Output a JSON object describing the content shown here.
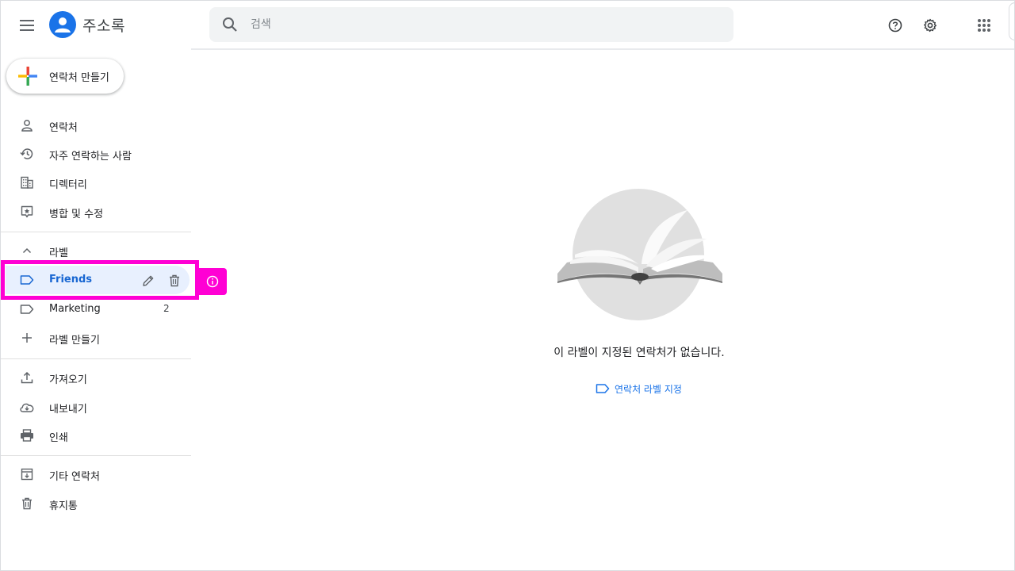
{
  "header": {
    "app_title": "주소록",
    "search_placeholder": "검색",
    "icons": {
      "menu": "hamburger-menu-icon",
      "logo": "contacts-person-icon",
      "search": "search-icon",
      "help": "help-icon",
      "settings": "gear-icon",
      "apps": "apps-grid-icon"
    }
  },
  "sidebar": {
    "create_label": "연락처 만들기",
    "nav": [
      {
        "label": "연락처",
        "icon": "person-icon"
      },
      {
        "label": "자주 연락하는 사람",
        "icon": "history-icon"
      },
      {
        "label": "디렉터리",
        "icon": "building-icon"
      },
      {
        "label": "병합 및 수정",
        "icon": "merge-fix-icon"
      }
    ],
    "labels_header": "라벨",
    "labels": [
      {
        "label": "Friends",
        "count": "",
        "selected": true
      },
      {
        "label": "Marketing",
        "count": "2",
        "selected": false
      }
    ],
    "create_label_item": "라벨 만들기",
    "tools": [
      {
        "label": "가져오기",
        "icon": "upload-icon"
      },
      {
        "label": "내보내기",
        "icon": "cloud-download-icon"
      },
      {
        "label": "인쇄",
        "icon": "printer-icon"
      }
    ],
    "other": [
      {
        "label": "기타 연락처",
        "icon": "archive-icon"
      },
      {
        "label": "휴지통",
        "icon": "trash-icon"
      }
    ]
  },
  "main": {
    "empty_message": "이 라벨이 지정된 연락처가 없습니다.",
    "assign_link": "연락처 라벨 지정"
  },
  "colors": {
    "accent": "#1a73e8",
    "selected_bg": "#e8f0fe",
    "highlight": "#ff00d4"
  }
}
